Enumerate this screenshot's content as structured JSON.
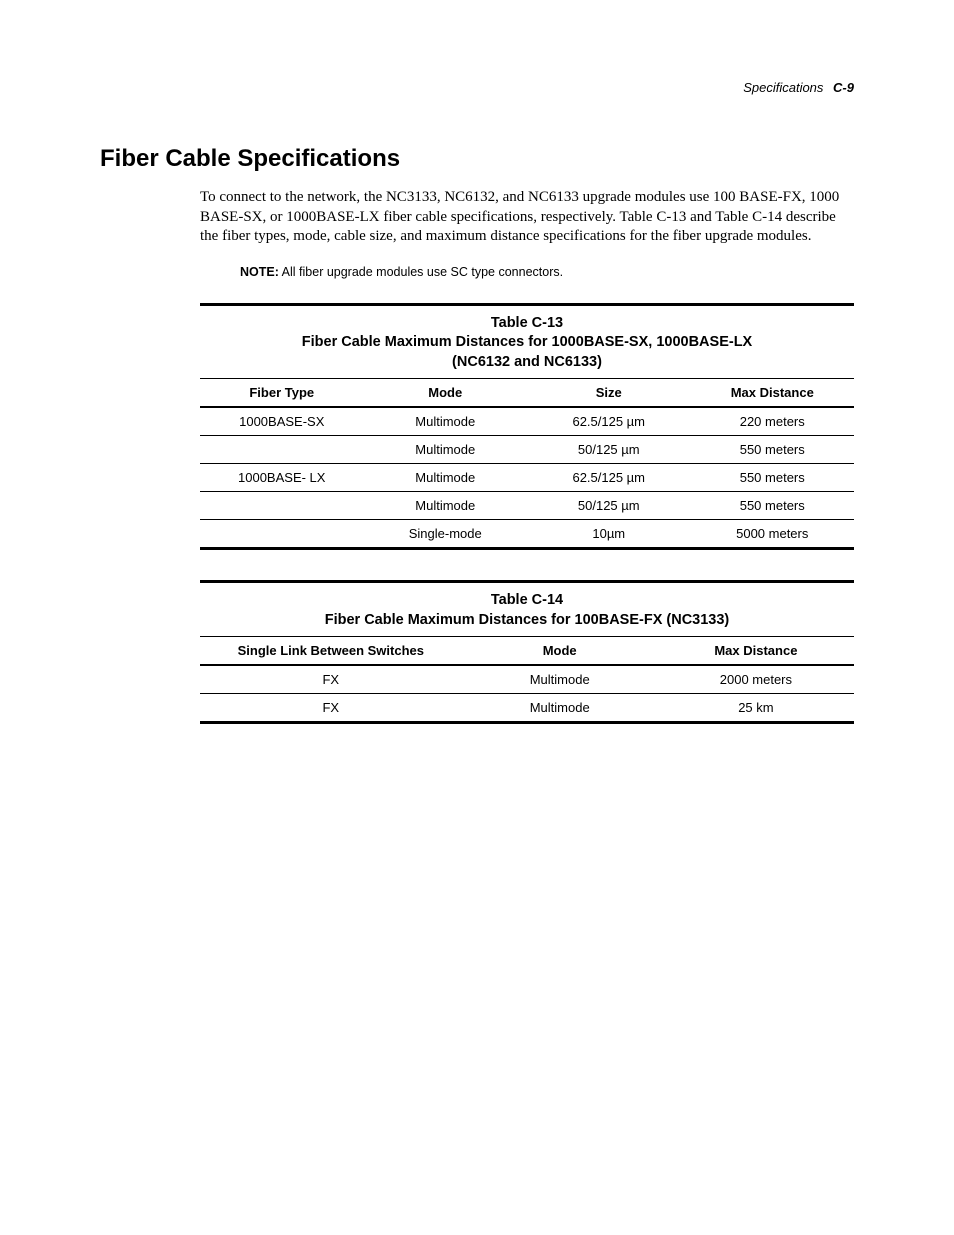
{
  "header": {
    "section": "Specifications",
    "pageNumber": "C-9"
  },
  "title": "Fiber Cable Specifications",
  "intro": "To connect to the network, the NC3133, NC6132, and NC6133 upgrade modules use 100 BASE-FX, 1000 BASE-SX, or 1000BASE-LX fiber cable specifications, respectively. Table C-13 and Table C-14 describe the fiber types, mode, cable size, and maximum distance specifications for the fiber upgrade modules.",
  "note": {
    "label": "NOTE:",
    "text": " All fiber upgrade modules use SC type connectors."
  },
  "table1": {
    "captionLine1": "Table C-13",
    "captionLine2": "Fiber Cable Maximum Distances for 1000BASE-SX, 1000BASE-LX",
    "captionLine3": "(NC6132 and NC6133)",
    "headers": [
      "Fiber Type",
      "Mode",
      "Size",
      "Max Distance"
    ],
    "rows": [
      [
        "1000BASE-SX",
        "Multimode",
        "62.5/125 µm",
        "220 meters"
      ],
      [
        "",
        "Multimode",
        "50/125 µm",
        "550 meters"
      ],
      [
        "1000BASE- LX",
        "Multimode",
        "62.5/125 µm",
        "550 meters"
      ],
      [
        "",
        "Multimode",
        "50/125 µm",
        "550 meters"
      ],
      [
        "",
        "Single-mode",
        "10µm",
        "5000 meters"
      ]
    ]
  },
  "table2": {
    "captionLine1": "Table C-14",
    "captionLine2": "Fiber Cable Maximum Distances for 100BASE-FX (NC3133)",
    "headers": [
      "Single Link Between Switches",
      "Mode",
      "Max Distance"
    ],
    "rows": [
      [
        "FX",
        "Multimode",
        "2000 meters"
      ],
      [
        "FX",
        "Multimode",
        "25 km"
      ]
    ]
  }
}
